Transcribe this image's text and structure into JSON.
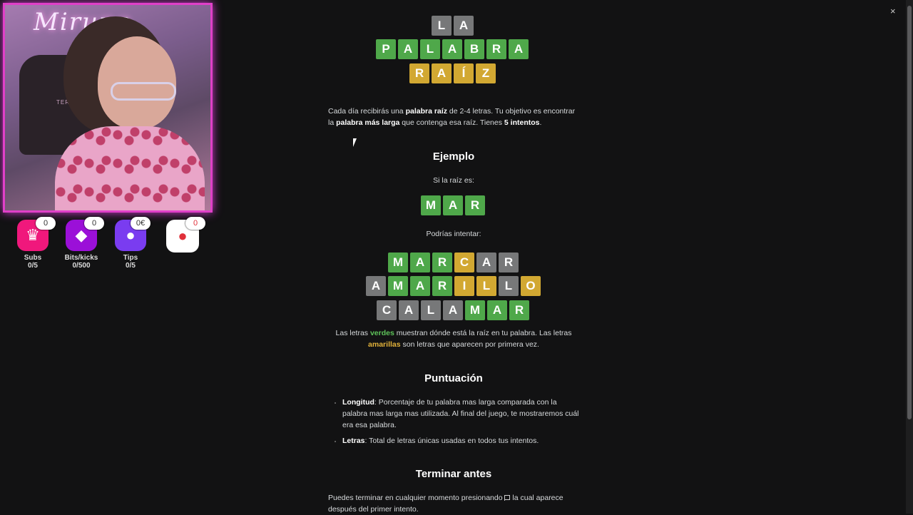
{
  "stream": {
    "overlay_sign": "Mirune",
    "chair_logo": "TERCET LAB",
    "stats": [
      {
        "label": "Subs",
        "value": "0/5",
        "badge": "0",
        "icon": "crown-icon",
        "color": "#f0187c"
      },
      {
        "label": "Bits/kicks",
        "value": "0/500",
        "badge": "0",
        "icon": "gem-icon",
        "color": "#9b10d8"
      },
      {
        "label": "Tips",
        "value": "0/5",
        "badge": "0€",
        "icon": "piggy-bank-icon",
        "color": "#7a3cf0"
      },
      {
        "label": "",
        "value": "",
        "badge": "0",
        "icon": "bomb-icon",
        "color": "#ffffff"
      }
    ]
  },
  "title_tiles": {
    "row1": [
      {
        "l": "L",
        "c": "x"
      },
      {
        "l": "A",
        "c": "x"
      }
    ],
    "row2": [
      {
        "l": "P",
        "c": "g"
      },
      {
        "l": "A",
        "c": "g"
      },
      {
        "l": "L",
        "c": "g"
      },
      {
        "l": "A",
        "c": "g"
      },
      {
        "l": "B",
        "c": "g"
      },
      {
        "l": "R",
        "c": "g"
      },
      {
        "l": "A",
        "c": "g"
      }
    ],
    "row3": [
      {
        "l": "R",
        "c": "y"
      },
      {
        "l": "A",
        "c": "y"
      },
      {
        "l": "Í",
        "c": "y"
      },
      {
        "l": "Z",
        "c": "y"
      }
    ]
  },
  "intro": {
    "p1": "Cada día recibirás una ",
    "b1": "palabra raíz",
    "p2": " de 2-4 letras. Tu objetivo es encontrar la ",
    "b2": "palabra más larga",
    "p3": " que contenga esa raíz. Tienes ",
    "b3": "5 intentos",
    "p4": "."
  },
  "example": {
    "heading": "Ejemplo",
    "root_label": "Si la raíz es:",
    "root": [
      {
        "l": "M",
        "c": "g"
      },
      {
        "l": "A",
        "c": "g"
      },
      {
        "l": "R",
        "c": "g"
      }
    ],
    "try_label": "Podrías intentar:",
    "words": [
      [
        {
          "l": "M",
          "c": "g"
        },
        {
          "l": "A",
          "c": "g"
        },
        {
          "l": "R",
          "c": "g"
        },
        {
          "l": "C",
          "c": "y"
        },
        {
          "l": "A",
          "c": "x"
        },
        {
          "l": "R",
          "c": "x"
        }
      ],
      [
        {
          "l": "A",
          "c": "x"
        },
        {
          "l": "M",
          "c": "g"
        },
        {
          "l": "A",
          "c": "g"
        },
        {
          "l": "R",
          "c": "g"
        },
        {
          "l": "I",
          "c": "y"
        },
        {
          "l": "L",
          "c": "y"
        },
        {
          "l": "L",
          "c": "x"
        },
        {
          "l": "O",
          "c": "y"
        }
      ],
      [
        {
          "l": "C",
          "c": "x"
        },
        {
          "l": "A",
          "c": "x"
        },
        {
          "l": "L",
          "c": "x"
        },
        {
          "l": "A",
          "c": "x"
        },
        {
          "l": "M",
          "c": "g"
        },
        {
          "l": "A",
          "c": "g"
        },
        {
          "l": "R",
          "c": "g"
        }
      ]
    ],
    "explain_p1": "Las letras ",
    "green_word": "verdes",
    "explain_p2": " muestran dónde está la raíz en tu palabra. Las letras ",
    "yellow_word": "amarillas",
    "explain_p3": " son letras que aparecen por primera vez."
  },
  "scoring": {
    "heading": "Puntuación",
    "item1_title": "Longitud",
    "item1_text": ": Porcentaje de tu palabra mas larga comparada con la palabra mas larga mas utilizada. Al final del juego, te mostraremos cuál era esa palabra.",
    "item2_title": "Letras",
    "item2_text": ": Total de letras únicas usadas en todos tus intentos."
  },
  "finish": {
    "heading": "Terminar antes",
    "p1": "Puedes terminar en cualquier momento presionando ",
    "p2": " la cual aparece después del primer intento."
  },
  "close_label": "×"
}
